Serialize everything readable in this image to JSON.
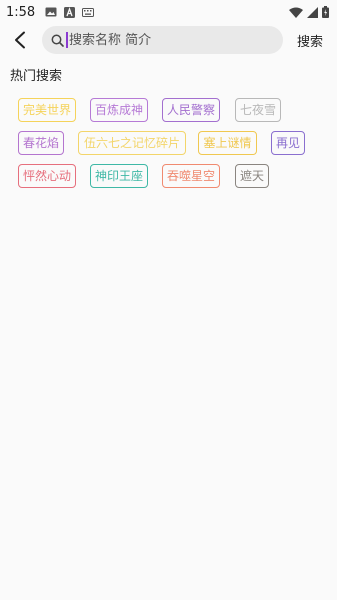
{
  "status_bar": {
    "time": "1:58",
    "left_icons": [
      "image-icon",
      "text-a-icon",
      "keyboard-icon"
    ],
    "right_icons": [
      "wifi-icon",
      "signal-icon",
      "battery-icon"
    ]
  },
  "header": {
    "back_icon": "chevron-left-icon",
    "search_placeholder": "搜索名称 简介",
    "search_label": "搜索"
  },
  "hot_search": {
    "title": "热门搜索",
    "tags": [
      {
        "label": "完美世界",
        "color": "#f5d35a"
      },
      {
        "label": "百炼成神",
        "color": "#b67ad6"
      },
      {
        "label": "人民警察",
        "color": "#a36fcf"
      },
      {
        "label": "七夜雪",
        "color": "#b8b8b8"
      },
      {
        "label": "春花焰",
        "color": "#b475cf"
      },
      {
        "label": "伍六七之记忆碎片",
        "color": "#f3d56a"
      },
      {
        "label": "塞上谜情",
        "color": "#f0c850"
      },
      {
        "label": "再见",
        "color": "#8a6fcf"
      },
      {
        "label": "怦然心动",
        "color": "#e66f7d"
      },
      {
        "label": "神印王座",
        "color": "#3fb8a6"
      },
      {
        "label": "吞噬星空",
        "color": "#f08a70"
      },
      {
        "label": "遮天",
        "color": "#8a8580"
      }
    ]
  }
}
